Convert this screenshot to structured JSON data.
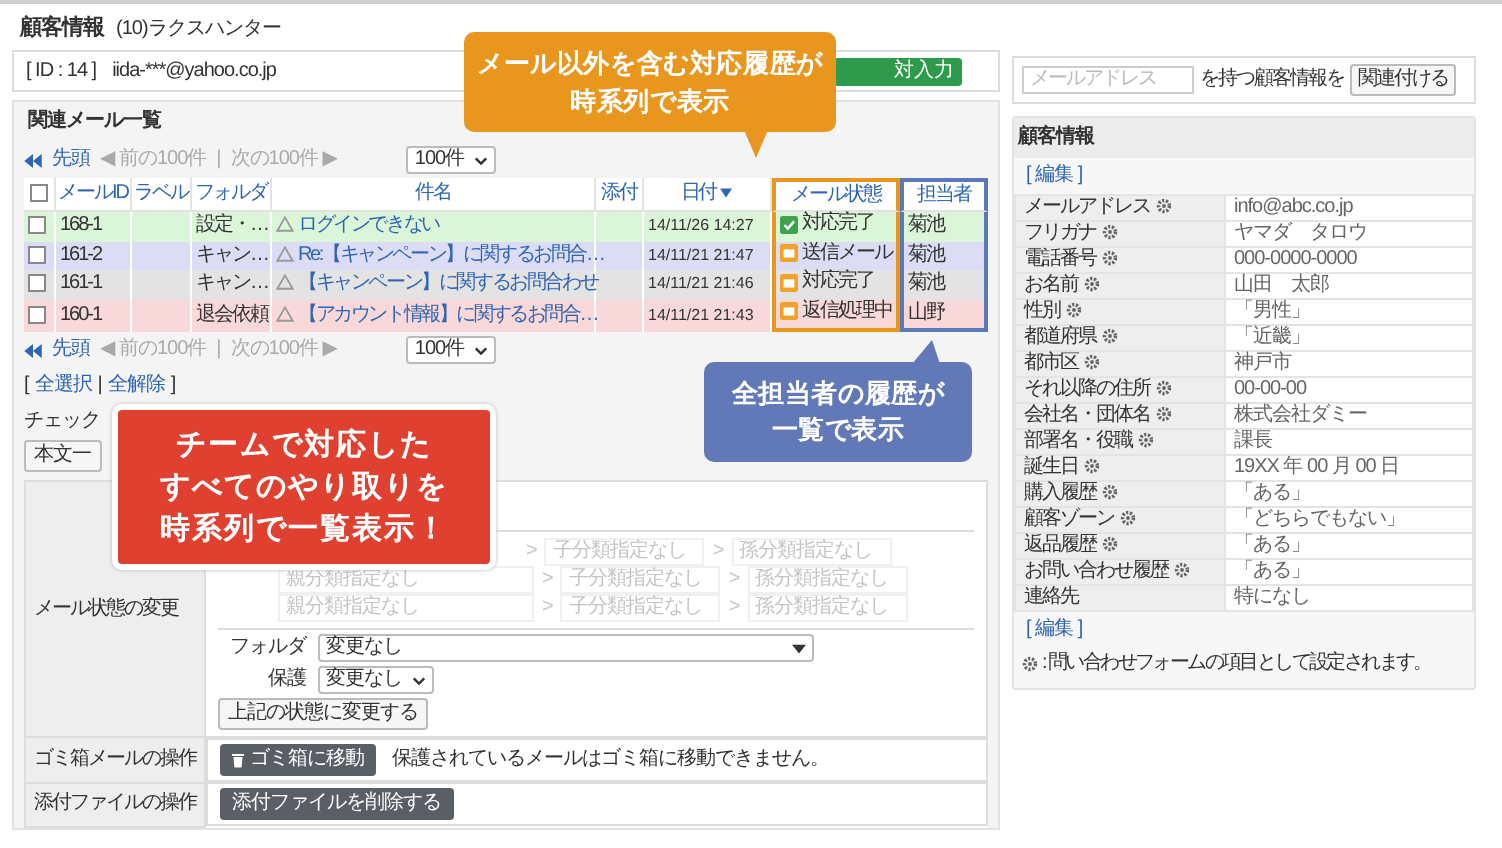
{
  "header": {
    "title": "顧客情報",
    "subtitle": "(10)ラクスハンター"
  },
  "contact_bar": {
    "id_label": "[ ID : 14 ]",
    "email": "iida-***@yahoo.co.jp",
    "button": "対入力"
  },
  "link_search": {
    "placeholder": "メールアドレス",
    "text": "を持つ顧客情報を",
    "button": "関連付ける"
  },
  "mail_list": {
    "title": "関連メール一覧",
    "pagers": [
      {
        "first": "先頭",
        "prev": "◀ 前の100件",
        "separator": "|",
        "next": "次の100件 ▶",
        "per_page": "100件"
      },
      {
        "first": "先頭",
        "prev": "◀ 前の100件",
        "separator": "|",
        "next": "次の100件 ▶",
        "per_page": "100件"
      }
    ],
    "header_checked": false,
    "columns": [
      {
        "label": "メールID",
        "sorted": false
      },
      {
        "label": "ラベル",
        "sorted": false
      },
      {
        "label": "フォルダ",
        "sorted": false
      },
      {
        "label": "件名",
        "sorted": false
      },
      {
        "label": "添付",
        "sorted": false
      },
      {
        "label": "日付",
        "sorted": true
      },
      {
        "label": "メール状態",
        "sorted": false
      },
      {
        "label": "担当者",
        "sorted": false
      }
    ],
    "rows": [
      {
        "checked": false,
        "color": "#dbf5d8",
        "id": "168-1",
        "folder": "設定・…",
        "subject": "ログインできない",
        "date": "14/11/26 14:27",
        "kind": "done",
        "status": "対応完了",
        "staff": "菊池"
      },
      {
        "checked": false,
        "color": "#dcdcf5",
        "id": "161-2",
        "folder": "キャン…",
        "subject": "Re:【キャンペーン】に関するお問合…",
        "date": "14/11/21 21:47",
        "kind": "mail",
        "status": "送信メール",
        "staff": "菊池"
      },
      {
        "checked": false,
        "color": "#e3e3e3",
        "id": "161-1",
        "folder": "キャン…",
        "subject": "【キャンペーン】に関するお問合わせ",
        "date": "14/11/21 21:46",
        "kind": "mail",
        "status": "対応完了",
        "staff": "菊池"
      },
      {
        "checked": false,
        "color": "#f8d8d8",
        "id": "160-1",
        "folder": "退会依頼",
        "subject": "【アカウント情報】に関するお問合…",
        "date": "14/11/21 21:43",
        "kind": "mail",
        "status": "返信処理中",
        "staff": "山野"
      }
    ],
    "select_links": {
      "open": "[",
      "all": "全選択",
      "separator": "|",
      "none": "全解除",
      "close": "]"
    },
    "check_label": "チェック",
    "body_button": "本文一"
  },
  "actions": {
    "status_change": {
      "label": "メール状態の変更",
      "category_rows": [
        {
          "disabled": true,
          "arrow_1": ">",
          "child": "子分類指定なし",
          "arrow_2": ">",
          "grandchild": "孫分類指定なし"
        },
        {
          "disabled": true,
          "parent": "親分類指定なし",
          "arrow_1": ">",
          "child": "子分類指定なし",
          "arrow_2": ">",
          "grandchild": "孫分類指定なし"
        },
        {
          "disabled": true,
          "parent": "親分類指定なし",
          "arrow_1": ">",
          "child": "子分類指定なし",
          "arrow_2": ">",
          "grandchild": "孫分類指定なし"
        }
      ],
      "folder_label": "フォルダ",
      "folder_value": "変更なし",
      "protect_label": "保護",
      "protect_value": "変更なし",
      "submit": "上記の状態に変更する"
    },
    "trash": {
      "label": "ゴミ箱メールの操作",
      "button": "ゴミ箱に移動",
      "note": "保護されているメールはゴミ箱に移動できません。"
    },
    "attachments": {
      "label": "添付ファイルの操作",
      "button": "添付ファイルを削除する"
    }
  },
  "customer": {
    "title": "顧客情報",
    "edit_top": "[ 編集 ]",
    "fields": [
      {
        "label": "メールアドレス",
        "form_item": true,
        "value": "info@abc.co.jp"
      },
      {
        "label": "フリガナ",
        "form_item": true,
        "value": "ヤマダ　タロウ"
      },
      {
        "label": "電話番号",
        "form_item": true,
        "value": "000-0000-0000"
      },
      {
        "label": "お名前",
        "form_item": true,
        "value": "山田　太郎"
      },
      {
        "label": "性別",
        "form_item": true,
        "value": "「男性」"
      },
      {
        "label": "都道府県",
        "form_item": true,
        "value": "「近畿」"
      },
      {
        "label": "都市区",
        "form_item": true,
        "value": "神戸市"
      },
      {
        "label": "それ以降の住所",
        "form_item": true,
        "value": "00-00-00"
      },
      {
        "label": "会社名・団体名",
        "form_item": true,
        "value": "株式会社ダミー"
      },
      {
        "label": "部署名・役職",
        "form_item": true,
        "value": "課長"
      },
      {
        "label": "誕生日",
        "form_item": true,
        "value": "19XX 年 00 月 00 日"
      },
      {
        "label": "購入履歴",
        "form_item": true,
        "value": "「ある」"
      },
      {
        "label": "顧客ゾーン",
        "form_item": true,
        "value": "「どちらでもない」"
      },
      {
        "label": "返品履歴",
        "form_item": true,
        "value": "「ある」"
      },
      {
        "label": "お問い合わせ履歴",
        "form_item": true,
        "value": "「ある」"
      },
      {
        "label": "連絡先",
        "form_item": false,
        "value": "特になし"
      }
    ],
    "edit_bottom": "[ 編集 ]",
    "note": ": 問い合わせフォームの項目として設定されます。"
  },
  "callouts": [
    {
      "color": "#e9961f",
      "lines": [
        "メール以外を含む対応履歴が",
        "時系列で表示"
      ]
    },
    {
      "color": "#e0402f",
      "lines": [
        "チームで対応した",
        "すべてのやり取りを",
        "時系列で一覧表示！"
      ]
    },
    {
      "color": "#6279b7",
      "lines": [
        "全担当者の履歴が",
        "一覧で表示"
      ]
    }
  ]
}
